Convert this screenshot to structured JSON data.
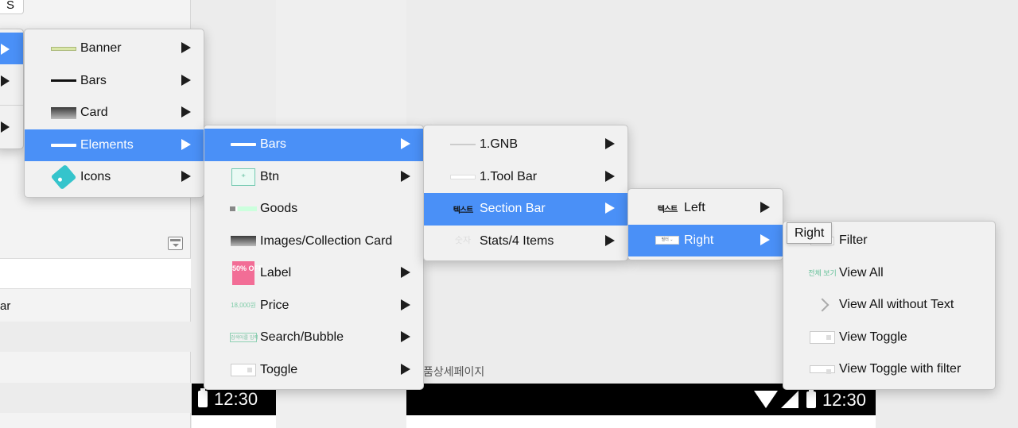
{
  "background": {
    "left_top_letter": "S",
    "left_row_text": "ar",
    "canvas_label": "품상세페이지",
    "status_time_left": "12:30",
    "status_time_right": "12:30",
    "accent_color": "#4a90f7"
  },
  "menu_categories": {
    "items": [
      {
        "label": "Banner",
        "icon": "banner-thumbnail"
      },
      {
        "label": "Bars",
        "icon": "bar-thumbnail"
      },
      {
        "label": "Card",
        "icon": "card-thumbnail"
      },
      {
        "label": "Elements",
        "icon": "bar-thumbnail",
        "selected": true
      },
      {
        "label": "Icons",
        "icon": "tag-icon"
      }
    ]
  },
  "menu_elements": {
    "items": [
      {
        "label": "Bars",
        "icon": "bar-thumbnail",
        "selected": true
      },
      {
        "label": "Btn",
        "icon": "button-thumbnail",
        "icon_text": "⁺"
      },
      {
        "label": "Goods",
        "icon": "goods-thumbnail"
      },
      {
        "label": "Images/Collection Card",
        "icon": "card-thumbnail"
      },
      {
        "label": "Label",
        "icon": "label-thumbnail",
        "icon_text": "50% OFF"
      },
      {
        "label": "Price",
        "icon": "price-thumbnail",
        "icon_text": "18,000원"
      },
      {
        "label": "Search/Bubble",
        "icon": "search-thumbnail",
        "icon_text": "검색어를 입력"
      },
      {
        "label": "Toggle",
        "icon": "toggle-thumbnail"
      }
    ]
  },
  "menu_bars": {
    "items": [
      {
        "label": "1.GNB",
        "icon": "line-thumbnail"
      },
      {
        "label": "1.Tool Bar",
        "icon": "bar-thumbnail"
      },
      {
        "label": "Section Bar",
        "icon": "text-thumbnail",
        "icon_text": "텍스트",
        "selected": true
      },
      {
        "label": "Stats/4 Items",
        "icon": "stats-thumbnail",
        "icon_text": "숫자"
      }
    ]
  },
  "menu_section_bar": {
    "items": [
      {
        "label": "Left",
        "icon": "text-thumbnail",
        "icon_text": "텍스트"
      },
      {
        "label": "Right",
        "icon": "right-thumbnail",
        "icon_text": "필터 ⌄",
        "selected": true
      }
    ]
  },
  "menu_right": {
    "items": [
      {
        "label": "Filter",
        "icon": "filter-thumbnail"
      },
      {
        "label": "View All",
        "icon": "view-all-thumbnail",
        "icon_text": "전체 보기"
      },
      {
        "label": "View All without Text",
        "icon": "chevron-right-icon"
      },
      {
        "label": "View Toggle",
        "icon": "toggle-thumbnail"
      },
      {
        "label": "View Toggle with filter",
        "icon": "toggle-filter-thumbnail"
      }
    ]
  },
  "tooltip": {
    "text": "Right"
  }
}
